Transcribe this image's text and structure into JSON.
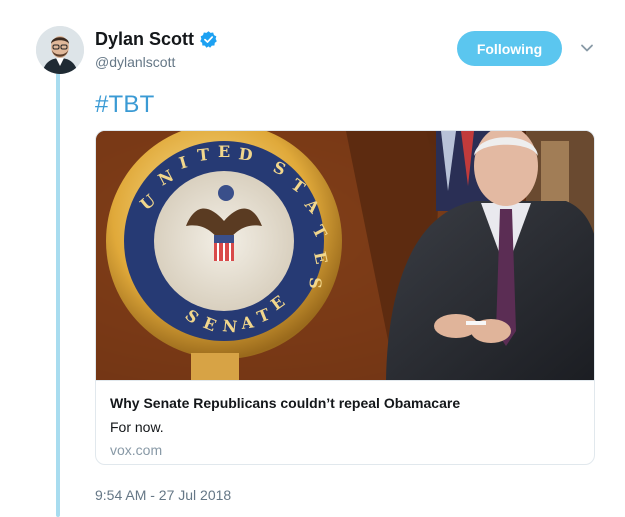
{
  "author": {
    "display_name": "Dylan Scott",
    "handle": "@dylanlscott",
    "verified": true,
    "verified_color": "#1da1f2"
  },
  "follow_button": {
    "label": "Following",
    "color": "#5bc6ef"
  },
  "menu": {
    "icon": "chevron-down-icon"
  },
  "tweet": {
    "hashtag": "#TBT",
    "hashtag_color": "#3a9ad4"
  },
  "card": {
    "title": "Why Senate Republicans couldn’t repeal Obamacare",
    "description": "For now.",
    "domain": "vox.com",
    "image_alt_desc": "senate-podium-with-senator-photo"
  },
  "footer": {
    "timestamp": "9:54 AM - 27 Jul 2018"
  }
}
